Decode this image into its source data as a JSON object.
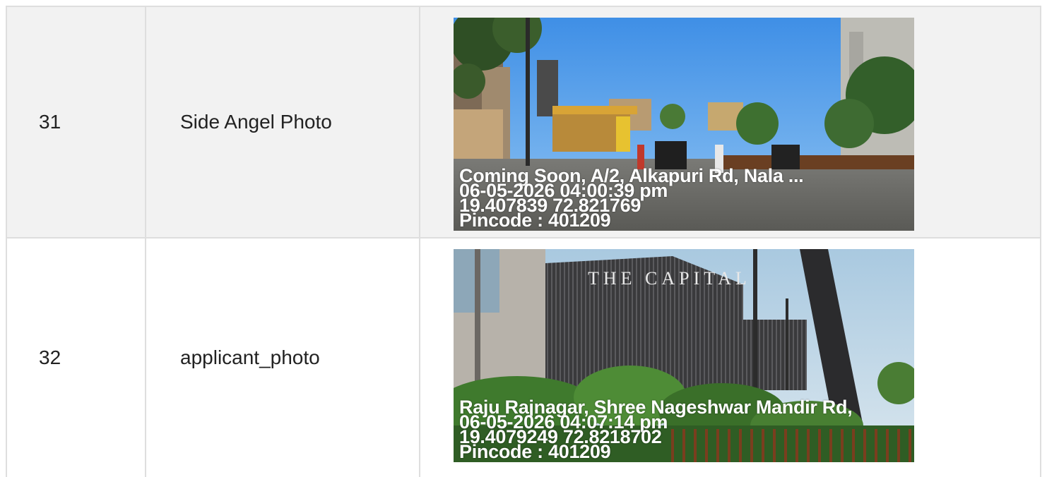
{
  "rows": [
    {
      "number": "31",
      "label": "Side Angel Photo",
      "photo": {
        "alt_icon": "street-scene-photo",
        "address": "Coming Soon, A/2, Alkapuri Rd, Nala ...",
        "datetime": "06-05-2026 04:00:39 pm",
        "coords": "19.407839 72.821769",
        "pincode": "Pincode : 401209"
      }
    },
    {
      "number": "32",
      "label": "applicant_photo",
      "photo": {
        "alt_icon": "building-photo",
        "address": "Raju Rajnagar, Shree Nageshwar Mandir Rd,",
        "datetime": "06-05-2026 04:07:14 pm",
        "coords": "19.4079249 72.8218702",
        "pincode": "Pincode : 401209",
        "signage": "THE CAPITAL"
      }
    }
  ],
  "colors": {
    "row_odd_bg": "#f2f2f2",
    "row_even_bg": "#ffffff",
    "border": "#dedede"
  }
}
